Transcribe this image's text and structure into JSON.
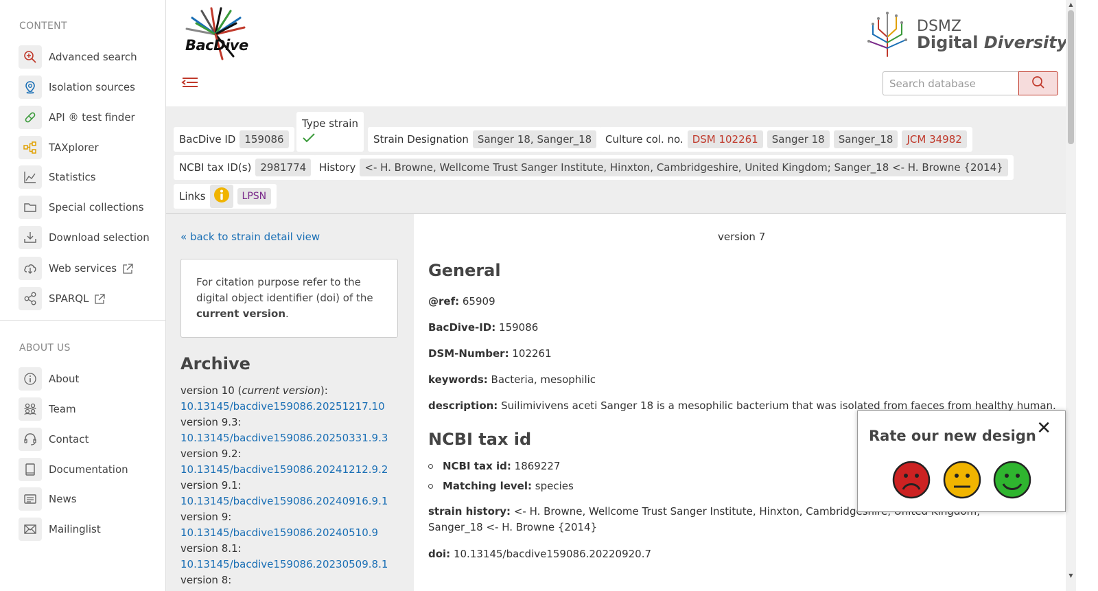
{
  "sidebar": {
    "content_title": "CONTENT",
    "content_items": [
      {
        "label": "Advanced search"
      },
      {
        "label": "Isolation sources"
      },
      {
        "label": "API ® test finder"
      },
      {
        "label": "TAXplorer"
      },
      {
        "label": "Statistics"
      },
      {
        "label": "Special collections"
      },
      {
        "label": "Download selection"
      },
      {
        "label": "Web services"
      },
      {
        "label": "SPARQL"
      }
    ],
    "about_title": "ABOUT US",
    "about_items": [
      {
        "label": "About"
      },
      {
        "label": "Team"
      },
      {
        "label": "Contact"
      },
      {
        "label": "Documentation"
      },
      {
        "label": "News"
      },
      {
        "label": "Mailinglist"
      }
    ]
  },
  "header": {
    "logo_bac": "Bac",
    "logo_dive": "Dive",
    "dsmz_line1": "DSMZ",
    "dsmz_line2_a": "Digital",
    "dsmz_line2_b": "Diversity",
    "search_placeholder": "Search database"
  },
  "info": {
    "bacdive_id_label": "BacDive ID",
    "bacdive_id": "159086",
    "type_strain_label": "Type strain",
    "strain_designation_label": "Strain Designation",
    "strain_designation": "Sanger 18, Sanger_18",
    "culture_label": "Culture col. no.",
    "culture_nos": [
      "DSM 102261",
      "Sanger 18",
      "Sanger_18",
      "JCM 34982"
    ],
    "ncbi_label": "NCBI tax ID(s)",
    "ncbi_id": "2981774",
    "history_label": "History",
    "history": "<- H. Browne, Wellcome Trust Sanger Institute, Hinxton, Cambridgeshire, United Kingdom; Sanger_18 <- H. Browne {2014}",
    "links_label": "Links",
    "lpsn": "LPSN"
  },
  "left": {
    "back_link": "« back to strain detail view",
    "cite_pre": "For citation purpose refer to the digital object identifier (doi) of the ",
    "cite_bold": "current version",
    "cite_post": ".",
    "archive_title": "Archive",
    "archive": [
      {
        "version": "version 10 (",
        "current": "current version",
        "after": "):",
        "doi": "10.13145/bacdive159086.20251217.10"
      },
      {
        "version": "version 9.3:",
        "current": "",
        "after": "",
        "doi": "10.13145/bacdive159086.20250331.9.3"
      },
      {
        "version": "version 9.2:",
        "current": "",
        "after": "",
        "doi": "10.13145/bacdive159086.20241212.9.2"
      },
      {
        "version": "version 9.1:",
        "current": "",
        "after": "",
        "doi": "10.13145/bacdive159086.20240916.9.1"
      },
      {
        "version": "version 9:",
        "current": "",
        "after": "",
        "doi": "10.13145/bacdive159086.20240510.9"
      },
      {
        "version": "version 8.1:",
        "current": "",
        "after": "",
        "doi": "10.13145/bacdive159086.20230509.8.1"
      },
      {
        "version": "version 8:",
        "current": "",
        "after": "",
        "doi": ""
      }
    ]
  },
  "main": {
    "version": "version 7",
    "general_title": "General",
    "ref_label": "@ref:",
    "ref_value": "65909",
    "bacdive_id_label": "BacDive-ID:",
    "bacdive_id_value": "159086",
    "dsm_label": "DSM-Number:",
    "dsm_value": "102261",
    "keywords_label": "keywords:",
    "keywords_value": "Bacteria, mesophilic",
    "description_label": "description:",
    "description_value": "Suilimivivens aceti Sanger 18 is a mesophilic bacterium that was isolated from faeces from healthy human.",
    "ncbi_title": "NCBI tax id",
    "ncbi_taxid_label": "NCBI tax id:",
    "ncbi_taxid_value": "1869227",
    "matching_label": "Matching level:",
    "matching_value": "species",
    "strain_history_label": "strain history:",
    "strain_history_value": "<- H. Browne, Wellcome Trust Sanger Institute, Hinxton, Cambridgeshire, United Kingdom; Sanger_18 <- H. Browne {2014}",
    "doi_label": "doi:",
    "doi_value": "10.13145/bacdive159086.20220920.7"
  },
  "rate": {
    "title": "Rate our new design",
    "close": "✕",
    "faces": [
      "sad-face-icon",
      "neutral-face-icon",
      "happy-face-icon"
    ]
  },
  "colors": {
    "accent": "#c0392b",
    "link": "#1a6fb5",
    "band": "#eeeeee"
  }
}
